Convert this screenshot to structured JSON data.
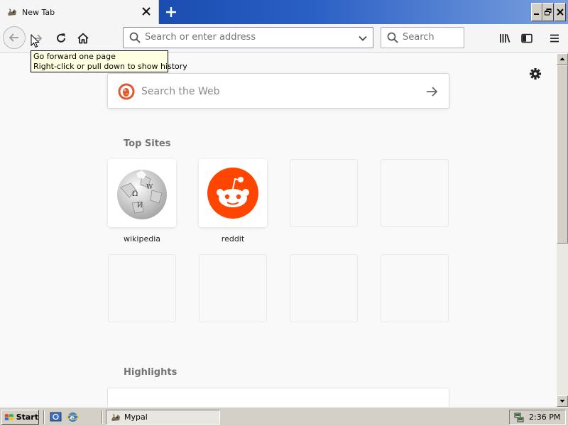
{
  "browser": {
    "tab": {
      "title": "New Tab",
      "favicon": "mypal-icon"
    },
    "nav": {
      "address_placeholder": "Search or enter address",
      "search_placeholder": "Search"
    },
    "tooltip": {
      "line1": "Go forward one page",
      "line2": "Right-click or pull down to show history"
    }
  },
  "newtab": {
    "web_search_placeholder": "Search the Web",
    "top_sites_title": "Top Sites",
    "sites": [
      {
        "label": "wikipedia",
        "icon": "wikipedia-globe-icon"
      },
      {
        "label": "reddit",
        "icon": "reddit-snoo-icon",
        "color": "#ff4500"
      }
    ],
    "highlights_title": "Highlights"
  },
  "taskbar": {
    "start_label": "Start",
    "task_label": "Mypal",
    "clock": "2:36 PM"
  },
  "colors": {
    "titlebar_start": "#0b3a9a",
    "titlebar_end": "#7aa0df",
    "reddit": "#ff4500",
    "duckduckgo": "#de5833",
    "tooltip_bg": "#ffffe1"
  }
}
